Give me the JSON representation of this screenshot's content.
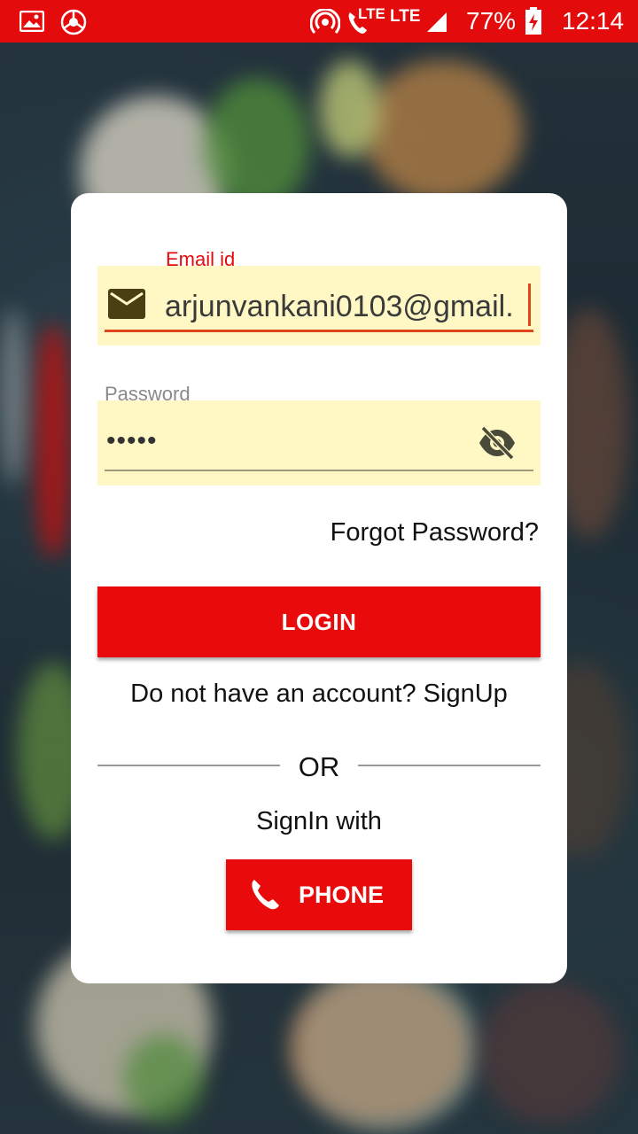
{
  "status_bar": {
    "battery": "77%",
    "time": "12:14",
    "network_label_1": "LTE",
    "network_label_2": "LTE",
    "icons": [
      "gallery-icon",
      "chrome-icon",
      "hotspot-icon",
      "volte-call-icon",
      "signal-icon",
      "battery-charging-icon"
    ]
  },
  "login_form": {
    "email": {
      "label": "Email id",
      "value": "arjunvankani0103@gmail.",
      "icon": "mail-icon"
    },
    "password": {
      "label": "Password",
      "value": "•••••",
      "icon": "visibility-off-icon"
    },
    "forgot_password": "Forgot Password?",
    "login_button": "LOGIN",
    "signup_text": "Do not have an account? SignUp",
    "divider_text": "OR",
    "signin_with": "SignIn with",
    "phone_button": "PHONE"
  },
  "colors": {
    "accent": "#e90b0b",
    "field_bg": "#fff8c4",
    "focus_underline": "#e0461b",
    "label_focused": "#e30b0b",
    "label_idle": "#8a8a8a"
  }
}
